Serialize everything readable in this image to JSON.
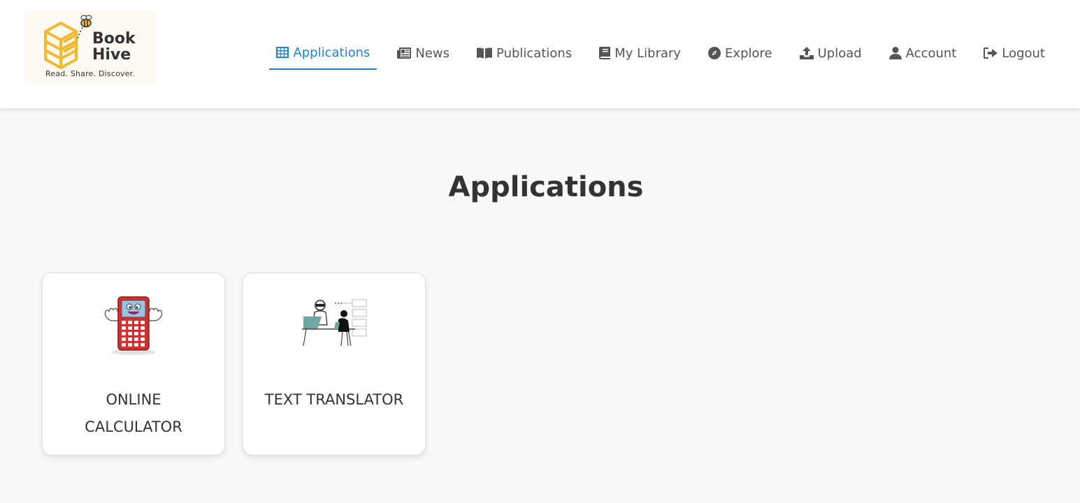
{
  "brand": {
    "name_line1": "Book",
    "name_line2": "Hive",
    "tagline": "Read. Share. Discover."
  },
  "nav": {
    "items": [
      {
        "label": "Applications",
        "icon": "grid-icon",
        "active": true
      },
      {
        "label": "News",
        "icon": "newspaper-icon"
      },
      {
        "label": "Publications",
        "icon": "book-open-icon"
      },
      {
        "label": "My Library",
        "icon": "book-icon"
      },
      {
        "label": "Explore",
        "icon": "compass-icon"
      },
      {
        "label": "Upload",
        "icon": "upload-icon"
      },
      {
        "label": "Account",
        "icon": "user-icon"
      },
      {
        "label": "Logout",
        "icon": "logout-icon"
      }
    ]
  },
  "main": {
    "title": "Applications",
    "apps": [
      {
        "label": "ONLINE CALCULATOR",
        "image": "calculator-mascot"
      },
      {
        "label": "TEXT TRANSLATOR",
        "image": "robot-translator-illustration"
      }
    ]
  },
  "colors": {
    "accent": "#1a86d8",
    "nav_text": "#555555",
    "text": "#333333",
    "page_bg": "#f8f8f8",
    "logo_yellow": "#f5b82e",
    "calculator_red": "#d32f2f"
  }
}
